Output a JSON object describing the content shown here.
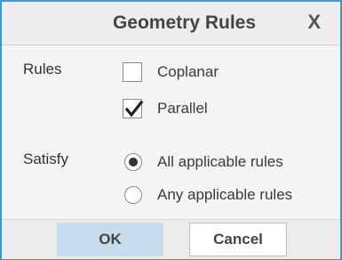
{
  "dialog": {
    "title": "Geometry Rules",
    "close_label": "X"
  },
  "rules": {
    "label": "Rules",
    "options": [
      {
        "label": "Coplanar",
        "checked": false
      },
      {
        "label": "Parallel",
        "checked": true
      }
    ]
  },
  "satisfy": {
    "label": "Satisfy",
    "options": [
      {
        "label": "All applicable rules",
        "selected": true
      },
      {
        "label": "Any applicable rules",
        "selected": false
      }
    ]
  },
  "buttons": {
    "ok_label": "OK",
    "cancel_label": "Cancel"
  },
  "colors": {
    "border_accent": "#3f97cf",
    "ok_button_bg": "#c7dced"
  }
}
